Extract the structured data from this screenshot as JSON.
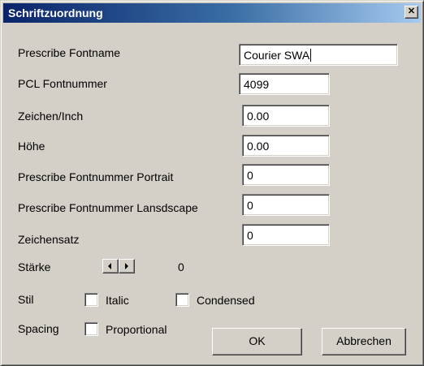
{
  "window": {
    "title": "Schriftzuordnung",
    "close_glyph": "✕"
  },
  "fields": [
    {
      "label": "Prescribe Fontname",
      "value": "Courier SWA"
    },
    {
      "label": "PCL Fontnummer",
      "value": "4099"
    },
    {
      "label": "Zeichen/Inch",
      "value": "0.00"
    },
    {
      "label": "Höhe",
      "value": "0.00"
    },
    {
      "label": "Prescribe Fontnummer Portrait",
      "value": "0"
    },
    {
      "label": "Prescribe Fontnummer Lansdscape",
      "value": "0"
    },
    {
      "label": "Zeichensatz",
      "value": "0"
    }
  ],
  "staerke": {
    "label": "Stärke",
    "value": "0"
  },
  "stil": {
    "label": "Stil",
    "italic_label": "Italic",
    "italic_checked": false,
    "condensed_label": "Condensed",
    "condensed_checked": false
  },
  "spacing": {
    "label": "Spacing",
    "proportional_label": "Proportional",
    "proportional_checked": false
  },
  "buttons": {
    "ok_label": "OK",
    "cancel_label": "Abbrechen"
  },
  "colors": {
    "dialog_face": "#d4d0c8",
    "title_start": "#0a246a",
    "title_end": "#a6caf0"
  }
}
